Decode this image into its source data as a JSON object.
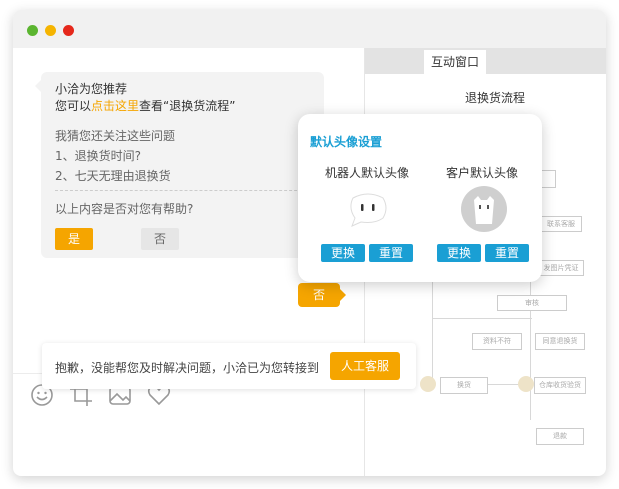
{
  "window": {
    "controls": [
      {
        "name": "minimize",
        "color": "#5bb530"
      },
      {
        "name": "maximize",
        "color": "#f5b400"
      },
      {
        "name": "close",
        "color": "#e5281b"
      }
    ]
  },
  "chat": {
    "recommend_line": "小洽为您推荐",
    "prefix": "您可以",
    "link": "点击这里",
    "suffix": "查看“退换货流程”",
    "faq_title": "我猜您还关注这些问题",
    "faq_items": [
      "1、退换货时间?",
      "2、七天无理由退换货"
    ],
    "helpful_question": "以上内容是否对您有帮助?",
    "yes_label": "是",
    "no_label": "否",
    "user_reply": "否"
  },
  "notice": {
    "text": "抱歉，没能帮您及时解决问题，小洽已为您转接到",
    "button": "人工客服"
  },
  "flow_panel": {
    "tab": "互动窗口",
    "title": "退换货流程",
    "boxes": [
      "联系客服",
      "发图片凭证",
      "审核",
      "资料不符",
      "同意退换货",
      "换货",
      "仓库收货验货",
      "退款"
    ]
  },
  "avatar_settings": {
    "title": "默认头像设置",
    "robot_label": "机器人默认头像",
    "customer_label": "客户默认头像",
    "change_label": "更换",
    "reset_label": "重置"
  },
  "colors": {
    "accent": "#f5a500",
    "blue": "#1a9fd4"
  },
  "toolbar": {
    "icons": [
      "emoji-icon",
      "crop-icon",
      "image-icon",
      "heart-icon"
    ]
  }
}
